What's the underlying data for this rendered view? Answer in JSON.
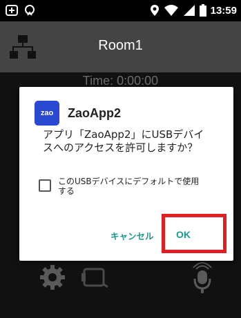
{
  "status_bar": {
    "time": "13:59",
    "icons": [
      "notification-icon",
      "phone-icon",
      "location-icon",
      "wifi-icon",
      "signal-icon",
      "battery-icon"
    ]
  },
  "app_bar": {
    "title": "Room1",
    "icon": "network-tree-icon",
    "background": "#444444"
  },
  "main": {
    "time_label": "Time: 0:00:00",
    "bottom_icons": [
      "gear-icon",
      "camera-rotate-icon",
      "microphone-icon"
    ]
  },
  "dialog": {
    "app_icon_text": "zao",
    "app_name": "ZaoApp2",
    "message": "アプリ「ZaoApp2」にUSBデバイスへのアクセスを許可しますか？",
    "checkbox_label": "このUSBデバイスにデフォルトで使用する",
    "checkbox_checked": false,
    "cancel_label": "キャンセル",
    "ok_label": "OK",
    "accent_color": "#1a9a8e",
    "highlight_color": "#e01e24"
  }
}
